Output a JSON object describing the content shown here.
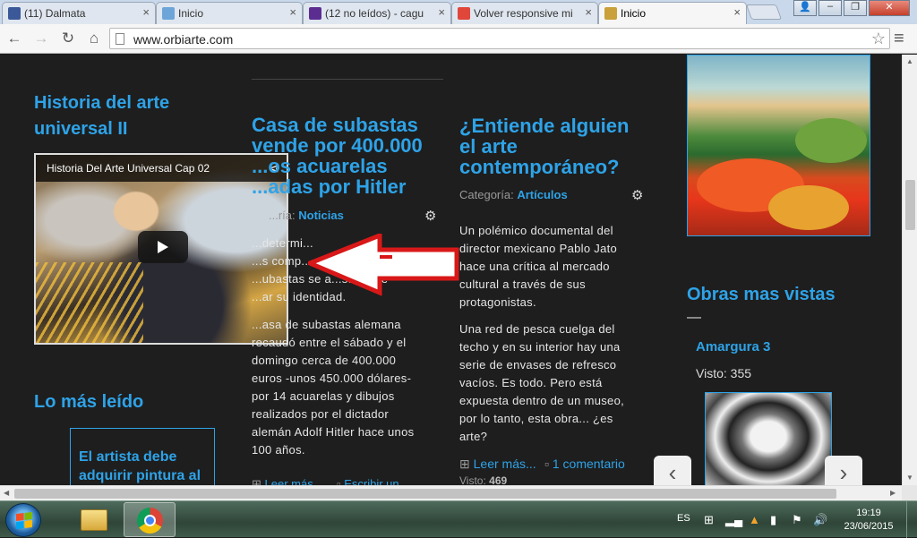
{
  "browser": {
    "tabs": [
      {
        "label": "(11) Dalmata",
        "icon_color": "#3b5998",
        "active": false
      },
      {
        "label": "Inicio",
        "icon_color": "#6ea5d8",
        "active": false
      },
      {
        "label": "(12 no leídos) - cagu",
        "icon_color": "#5c2d91",
        "active": false
      },
      {
        "label": "Volver responsive mi",
        "icon_color": "#e0463a",
        "active": false
      },
      {
        "label": "Inicio",
        "icon_color": "#c9a03a",
        "active": true
      }
    ],
    "close_glyph": "×",
    "url": "www.orbiarte.com"
  },
  "left_column": {
    "widget1_title": "Historia del arte universal II",
    "video_title": "Historia Del Arte Universal Cap 02",
    "widget2_title": "Lo más leído",
    "most_read_item": "El artista debe adquirir pintura al"
  },
  "post1": {
    "title": "Casa de subastas vende por 400.000 ...os acuarelas ...adas por Hitler",
    "title_lines": [
      "Casa de subastas",
      "vende por 400.000",
      "...os acuarelas",
      "...adas por Hitler"
    ],
    "category_prefix": "...ría:",
    "category": "Noticias",
    "para1_lines": [
      "...determi...",
      "...s comp...",
      "...ubastas se a...stuvo de",
      "...ar su identidad."
    ],
    "para2_lines": [
      "...asa de subastas alemana",
      "recaudó entre el sábado y el",
      "domingo cerca de 400.000",
      "euros -unos 450.000 dólares-",
      "por 14 acuarelas y dibujos",
      "realizados por el dictador",
      "alemán Adolf Hitler hace unos",
      "100 años."
    ],
    "read_more": "Leer más...",
    "comment": "Escribir un"
  },
  "post2": {
    "title_lines": [
      "¿Entiende alguien",
      "el arte",
      "contemporáneo?"
    ],
    "category_prefix": "Categoría:",
    "category": "Artículos",
    "para1_lines": [
      "Un polémico documental del",
      "director mexicano Pablo Jato",
      "hace una crítica al mercado",
      "cultural a través de sus",
      "protagonistas."
    ],
    "para2_lines": [
      "Una red de pesca cuelga del",
      "techo y en su interior hay una",
      "serie de envases de refresco",
      "vacíos. Es todo. Pero está",
      "expuesta dentro de un museo,",
      "por lo tanto, esta obra... ¿es",
      "arte?"
    ],
    "read_more": "Leer más...",
    "comments": "1 comentario",
    "views_label": "Visto:",
    "views": "469"
  },
  "right_column": {
    "widget_title": "Obras mas vistas",
    "dash": "—",
    "item_title": "Amargura 3",
    "views_label": "Visto:",
    "views": "355"
  },
  "slider": {
    "prev": "‹",
    "next": "›"
  },
  "taskbar": {
    "language": "ES",
    "time": "19:19",
    "date": "23/06/2015"
  }
}
